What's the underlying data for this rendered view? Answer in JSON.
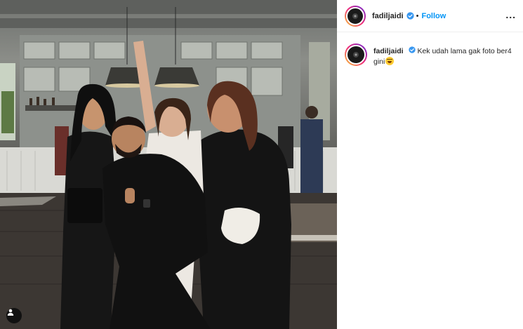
{
  "post": {
    "username": "fadiljaidi",
    "follow_label": "Follow",
    "separator": "•",
    "more_label": "...",
    "caption": "Kek udah lama gak foto ber4 gini",
    "caption_emoji": "grinning-sweat-emoji"
  },
  "colors": {
    "follow": "#0095f6",
    "verified": "#3897f0",
    "avatar_ring_start": "#f9ce34",
    "avatar_ring_mid": "#ee2a7b",
    "avatar_ring_end": "#6228d7"
  },
  "icons": {
    "verified": "verified-badge-icon",
    "tag": "user-tag-icon",
    "more": "more-options-icon"
  }
}
